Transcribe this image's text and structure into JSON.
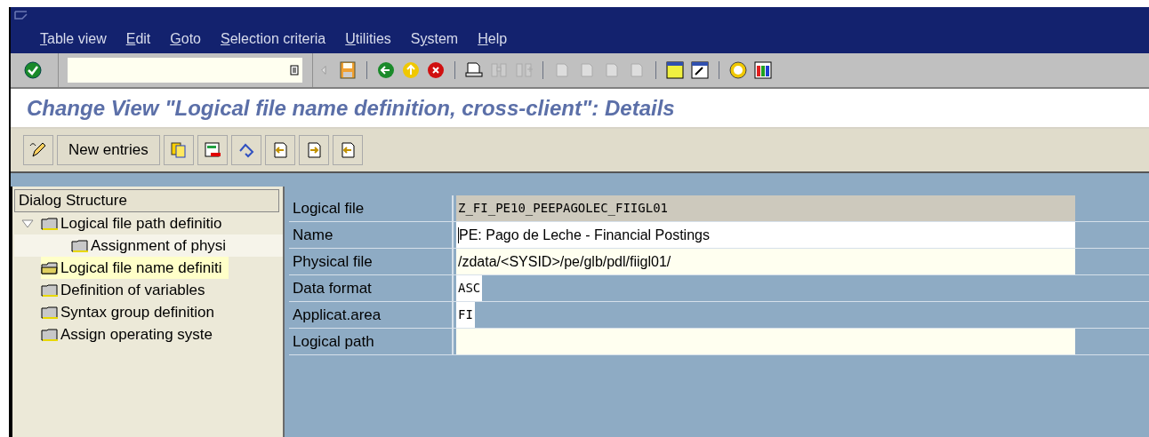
{
  "menu_bar": {
    "items": [
      {
        "key": "T",
        "rest": "able view"
      },
      {
        "key": "E",
        "rest": "dit"
      },
      {
        "key": "G",
        "rest": "oto"
      },
      {
        "key": "S",
        "rest": "election criteria"
      },
      {
        "key": "U",
        "rest": "tilities"
      },
      {
        "lead": "S",
        "key": "y",
        "rest": "stem"
      },
      {
        "key": "H",
        "rest": "elp"
      }
    ]
  },
  "title": "Change View \"Logical file name definition, cross-client\": Details",
  "app_toolbar": {
    "buttons": [
      {
        "label": "New entries"
      }
    ]
  },
  "dialog_structure": {
    "title": "Dialog Structure",
    "items": [
      {
        "label": "Logical file path definitio",
        "selected": false,
        "expanded": true,
        "children": [
          {
            "label": "Assignment of physi",
            "selected": false
          }
        ]
      },
      {
        "label": "Logical file name definiti",
        "selected": true
      },
      {
        "label": "Definition of variables",
        "selected": false
      },
      {
        "label": "Syntax group definition",
        "selected": false
      },
      {
        "label": "Assign operating syste",
        "selected": false
      }
    ]
  },
  "fields": [
    {
      "label": "Logical file",
      "value": "Z_FI_PE10_PEEPAGOLEC_FIIGL01",
      "kind": "display",
      "mono": true,
      "short": false
    },
    {
      "label": "Name",
      "value": "PE:  Pago de Leche - Financial Postings",
      "kind": "input",
      "mono": false,
      "short": false,
      "focused": true
    },
    {
      "label": "Physical file",
      "value": "/zdata/<SYSID>/pe/glb/pdl/fiigl01/",
      "kind": "optional",
      "mono": false,
      "short": false
    },
    {
      "label": "Data format",
      "value": "ASC",
      "kind": "input",
      "mono": true,
      "short": true
    },
    {
      "label": "Applicat.area",
      "value": "FI",
      "kind": "input",
      "mono": true,
      "short": true
    },
    {
      "label": "Logical path",
      "kind": "optional",
      "short": false
    }
  ]
}
